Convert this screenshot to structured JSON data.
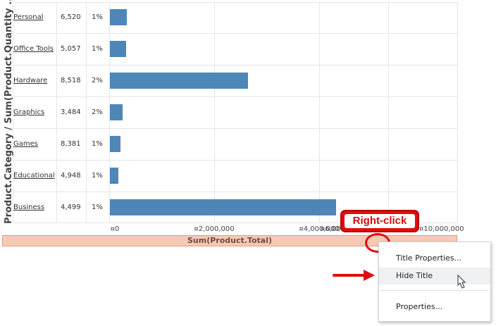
{
  "chart": {
    "y_axis_title": "Product.Category / Sum(Product.Quantity ...",
    "x_axis_title": "Sum(Product.Total)",
    "x_ticks": [
      "¤0",
      "¤2,000,000",
      "¤4,000,000",
      "¤6,000,000",
      "¤10,000,000"
    ]
  },
  "chart_data": {
    "type": "bar",
    "orientation": "horizontal",
    "categories": [
      "Personal",
      "Office Tools",
      "Hardware",
      "Graphics",
      "Games",
      "Educational",
      "Business"
    ],
    "quantities": [
      "6,520",
      "5,057",
      "8,518",
      "3,484",
      "8,381",
      "4,948",
      "4,499"
    ],
    "percents": [
      "1%",
      "1%",
      "2%",
      "2%",
      "1%",
      "1%",
      "1%"
    ],
    "values": [
      400000,
      380000,
      3300000,
      300000,
      250000,
      200000,
      5400000
    ],
    "xlabel": "Sum(Product.Total)",
    "ylabel": "Product.Category / Sum(Product.Quantity ...",
    "xlim": [
      0,
      10000000
    ],
    "grid": true
  },
  "callout": {
    "text": "Right-click"
  },
  "context_menu": {
    "items": [
      "Title Properties...",
      "Hide Title",
      "Properties..."
    ],
    "hovered": "Hide Title"
  },
  "colors": {
    "bar": "#4f86b8",
    "callout": "#e10d0d",
    "axis_title_bg": "#f7c9b5"
  }
}
